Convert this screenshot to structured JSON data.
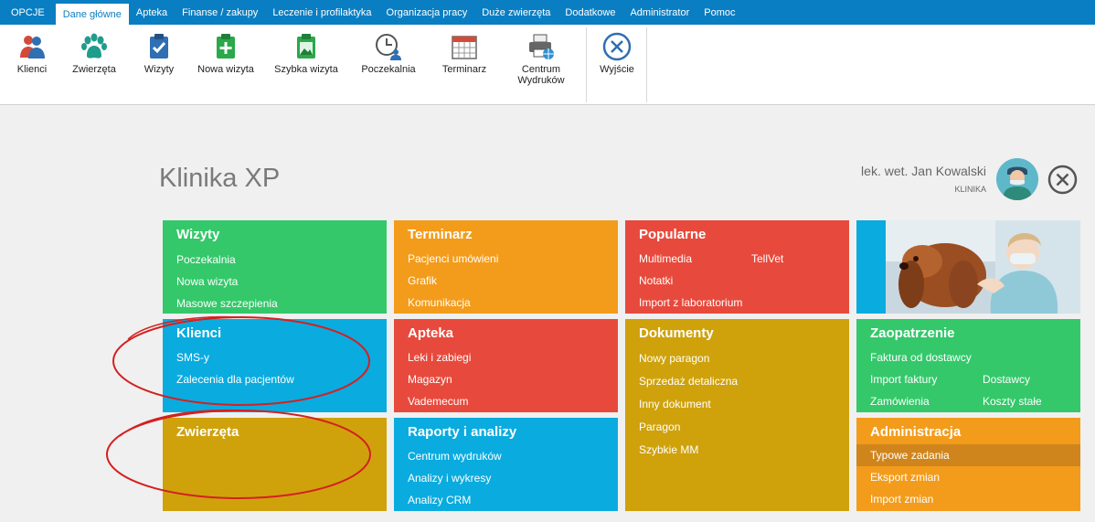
{
  "menu": {
    "items": [
      "OPCJE",
      "Dane główne",
      "Apteka",
      "Finanse / zakupy",
      "Leczenie i profilaktyka",
      "Organizacja pracy",
      "Duże zwierzęta",
      "Dodatkowe",
      "Administrator",
      "Pomoc"
    ],
    "active": "Dane główne"
  },
  "ribbon": {
    "klienci": "Klienci",
    "zwierzeta": "Zwierzęta",
    "wizyty": "Wizyty",
    "nowa_wizyta": "Nowa wizyta",
    "szybka_wizyta": "Szybka wizyta",
    "poczekalnia": "Poczekalnia",
    "terminarz": "Terminarz",
    "centrum_line1": "Centrum",
    "centrum_line2": "Wydruków",
    "wyjscie": "Wyjście"
  },
  "header": {
    "clinic": "Klinika XP",
    "user_name": "lek. wet. Jan Kowalski",
    "user_role": "KLINIKA"
  },
  "tiles": {
    "wizyty": {
      "title": "Wizyty",
      "links": [
        "Poczekalnia",
        "Nowa wizyta",
        "Masowe szczepienia"
      ]
    },
    "terminarz": {
      "title": "Terminarz",
      "links": [
        "Pacjenci umówieni",
        "Grafik",
        "Komunikacja"
      ]
    },
    "popularne": {
      "title": "Popularne",
      "links": [
        "Multimedia",
        "TellVet",
        "Notatki",
        "Import z laboratorium"
      ]
    },
    "klienci": {
      "title": "Klienci",
      "links": [
        "SMS-y",
        "Zalecenia dla pacjentów"
      ]
    },
    "apteka": {
      "title": "Apteka",
      "links": [
        "Leki i zabiegi",
        "Magazyn",
        "Vademecum"
      ]
    },
    "dokumenty": {
      "title": "Dokumenty",
      "links": [
        "Nowy paragon",
        "Sprzedaż detaliczna",
        "Inny dokument",
        "Paragon",
        "Szybkie MM"
      ]
    },
    "zaopatrzenie": {
      "title": "Zaopatrzenie",
      "links": [
        "Faktura od dostawcy",
        "Import faktury",
        "Dostawcy",
        "Zamówienia",
        "Koszty stałe"
      ]
    },
    "zwierzeta": {
      "title": "Zwierzęta",
      "links": []
    },
    "raporty": {
      "title": "Raporty i analizy",
      "links": [
        "Centrum wydruków",
        "Analizy i wykresy",
        "Analizy CRM"
      ]
    },
    "administracja": {
      "title": "Administracja",
      "links": [
        "Typowe zadania",
        "Eksport zmian",
        "Import zmian"
      ]
    }
  },
  "colors": {
    "menubar": "#0a7ec2",
    "green": "#34c86a",
    "orange": "#f39c1b",
    "red": "#e74a3c",
    "blue": "#0aabdf",
    "mustard": "#cfa20c",
    "annotation": "#d42020"
  },
  "icons": {
    "klienci": "people-icon",
    "zwierzeta": "paw-icon",
    "wizyty": "clipboard-check-icon",
    "nowa_wizyta": "clipboard-plus-icon",
    "szybka_wizyta": "clipboard-image-icon",
    "poczekalnia": "clock-person-icon",
    "terminarz": "calendar-icon",
    "centrum": "printer-globe-icon",
    "wyjscie": "exit-icon"
  }
}
